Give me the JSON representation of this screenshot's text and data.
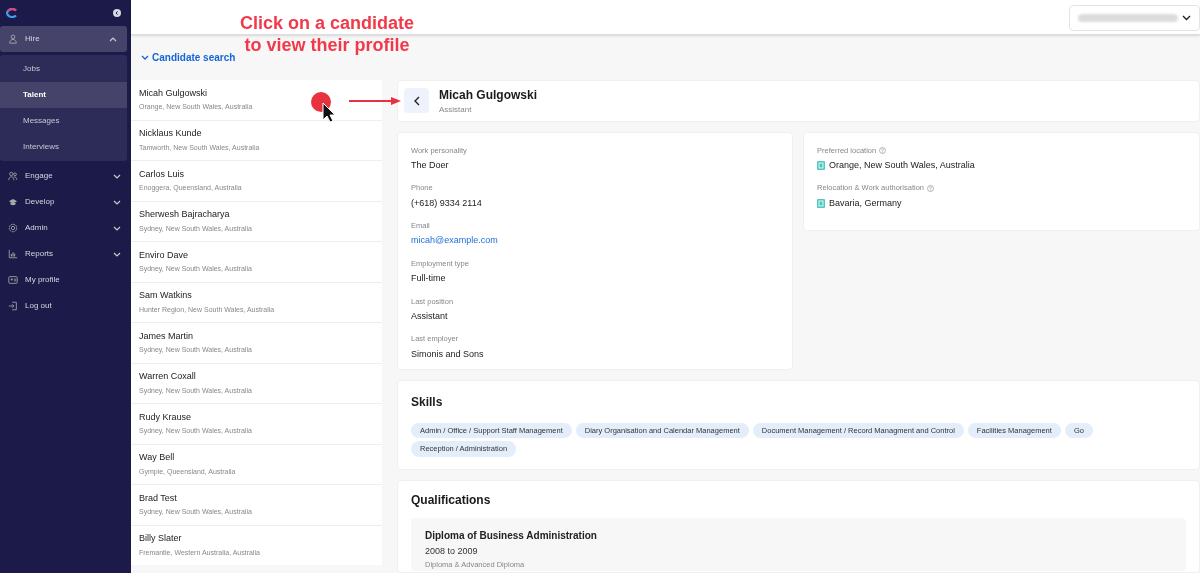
{
  "sidebar": {
    "items": [
      {
        "label": "Hire",
        "kind": "group",
        "expanded": true,
        "children": [
          {
            "label": "Jobs",
            "selected": false
          },
          {
            "label": "Talent",
            "selected": true
          },
          {
            "label": "Messages",
            "selected": false
          },
          {
            "label": "Interviews",
            "selected": false
          }
        ]
      },
      {
        "label": "Engage",
        "kind": "group",
        "expanded": false
      },
      {
        "label": "Develop",
        "kind": "group",
        "expanded": false
      },
      {
        "label": "Admin",
        "kind": "group",
        "expanded": false
      },
      {
        "label": "Reports",
        "kind": "group",
        "expanded": false
      },
      {
        "label": "My profile",
        "kind": "link"
      },
      {
        "label": "Log out",
        "kind": "link"
      }
    ]
  },
  "search_toggle": {
    "label": "Candidate search"
  },
  "candidates": [
    {
      "name": "Micah Gulgowski",
      "location": "Orange, New South Wales, Australia"
    },
    {
      "name": "Nicklaus Kunde",
      "location": "Tamworth, New South Wales, Australia"
    },
    {
      "name": "Carlos Luis",
      "location": "Enoggera, Queensland, Australia"
    },
    {
      "name": "Sherwesh Bajracharya",
      "location": "Sydney, New South Wales, Australia"
    },
    {
      "name": "Enviro Dave",
      "location": "Sydney, New South Wales, Australia"
    },
    {
      "name": "Sam Watkins",
      "location": "Hunter Region, New South Wales, Australia"
    },
    {
      "name": "James Martin",
      "location": "Sydney, New South Wales, Australia"
    },
    {
      "name": "Warren Coxall",
      "location": "Sydney, New South Wales, Australia"
    },
    {
      "name": "Rudy Krause",
      "location": "Sydney, New South Wales, Australia"
    },
    {
      "name": "Way Bell",
      "location": "Gympie, Queensland, Australia"
    },
    {
      "name": "Brad Test",
      "location": "Sydney, New South Wales, Australia"
    },
    {
      "name": "Billy Slater",
      "location": "Fremantle, Western Australia, Australia"
    }
  ],
  "annotation": {
    "text": "Click on a candidate to view their profile"
  },
  "profile": {
    "name": "Micah Gulgowski",
    "title": "Assistant",
    "details": [
      {
        "label": "Work personality",
        "value": "The Doer",
        "kind": "text"
      },
      {
        "label": "Phone",
        "value": "(+618) 9334 2114",
        "kind": "text"
      },
      {
        "label": "Email",
        "value": "micah@example.com",
        "kind": "link"
      },
      {
        "label": "Employment type",
        "value": "Full-time",
        "kind": "text"
      },
      {
        "label": "Last position",
        "value": "Assistant",
        "kind": "text"
      },
      {
        "label": "Last employer",
        "value": "Simonis and Sons",
        "kind": "text"
      }
    ],
    "locations": [
      {
        "label": "Preferred location",
        "value": "Orange, New South Wales, Australia"
      },
      {
        "label": "Relocation & Work authorisation",
        "value": "Bavaria, Germany"
      }
    ],
    "skills_title": "Skills",
    "skills": [
      "Admin / Office / Support Staff Management",
      "Diary Organisation and Calendar Management",
      "Document Management / Record Managment and Control",
      "Facilities Management",
      "Go",
      "Reception / Administration"
    ],
    "qualifications_title": "Qualifications",
    "qualifications": [
      {
        "title": "Diploma of Business Administration",
        "years": "2008 to 2009",
        "level": "Diploma & Advanced Diploma"
      }
    ]
  }
}
